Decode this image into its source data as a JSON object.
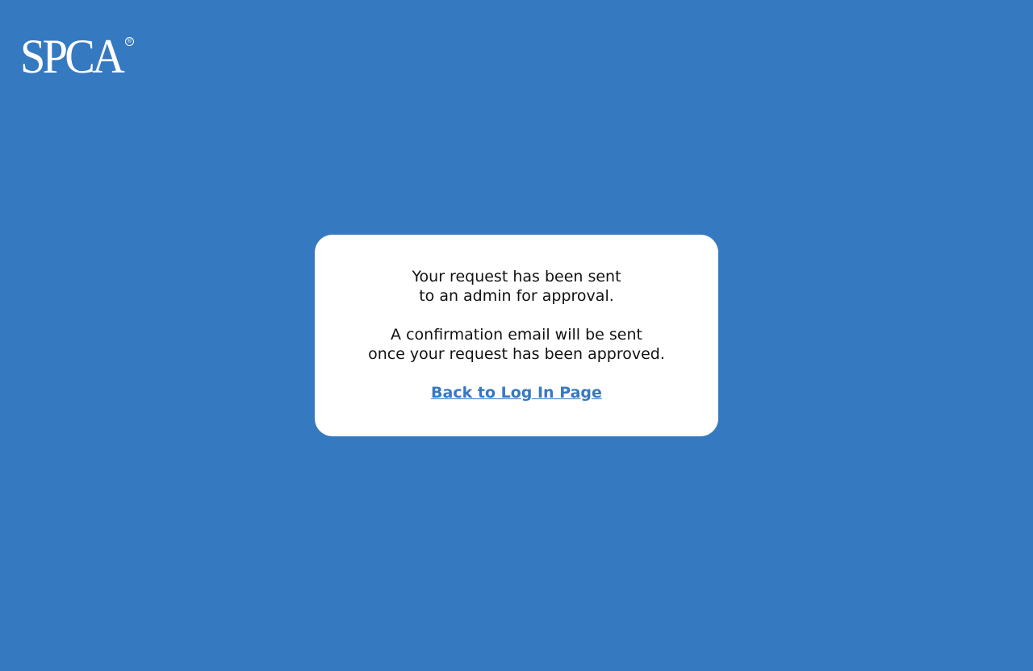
{
  "brand": {
    "logo_text": "SPCA",
    "registered_mark": "®",
    "background_color": "#3579C1",
    "card_color": "#FFFFFF",
    "link_color": "#3579C1"
  },
  "message": {
    "line1": "Your request has been sent",
    "line2": "to an admin for approval.",
    "line3": "A confirmation email will be sent",
    "line4": "once your request has been approved."
  },
  "actions": {
    "back_label": "Back to Log In Page"
  }
}
